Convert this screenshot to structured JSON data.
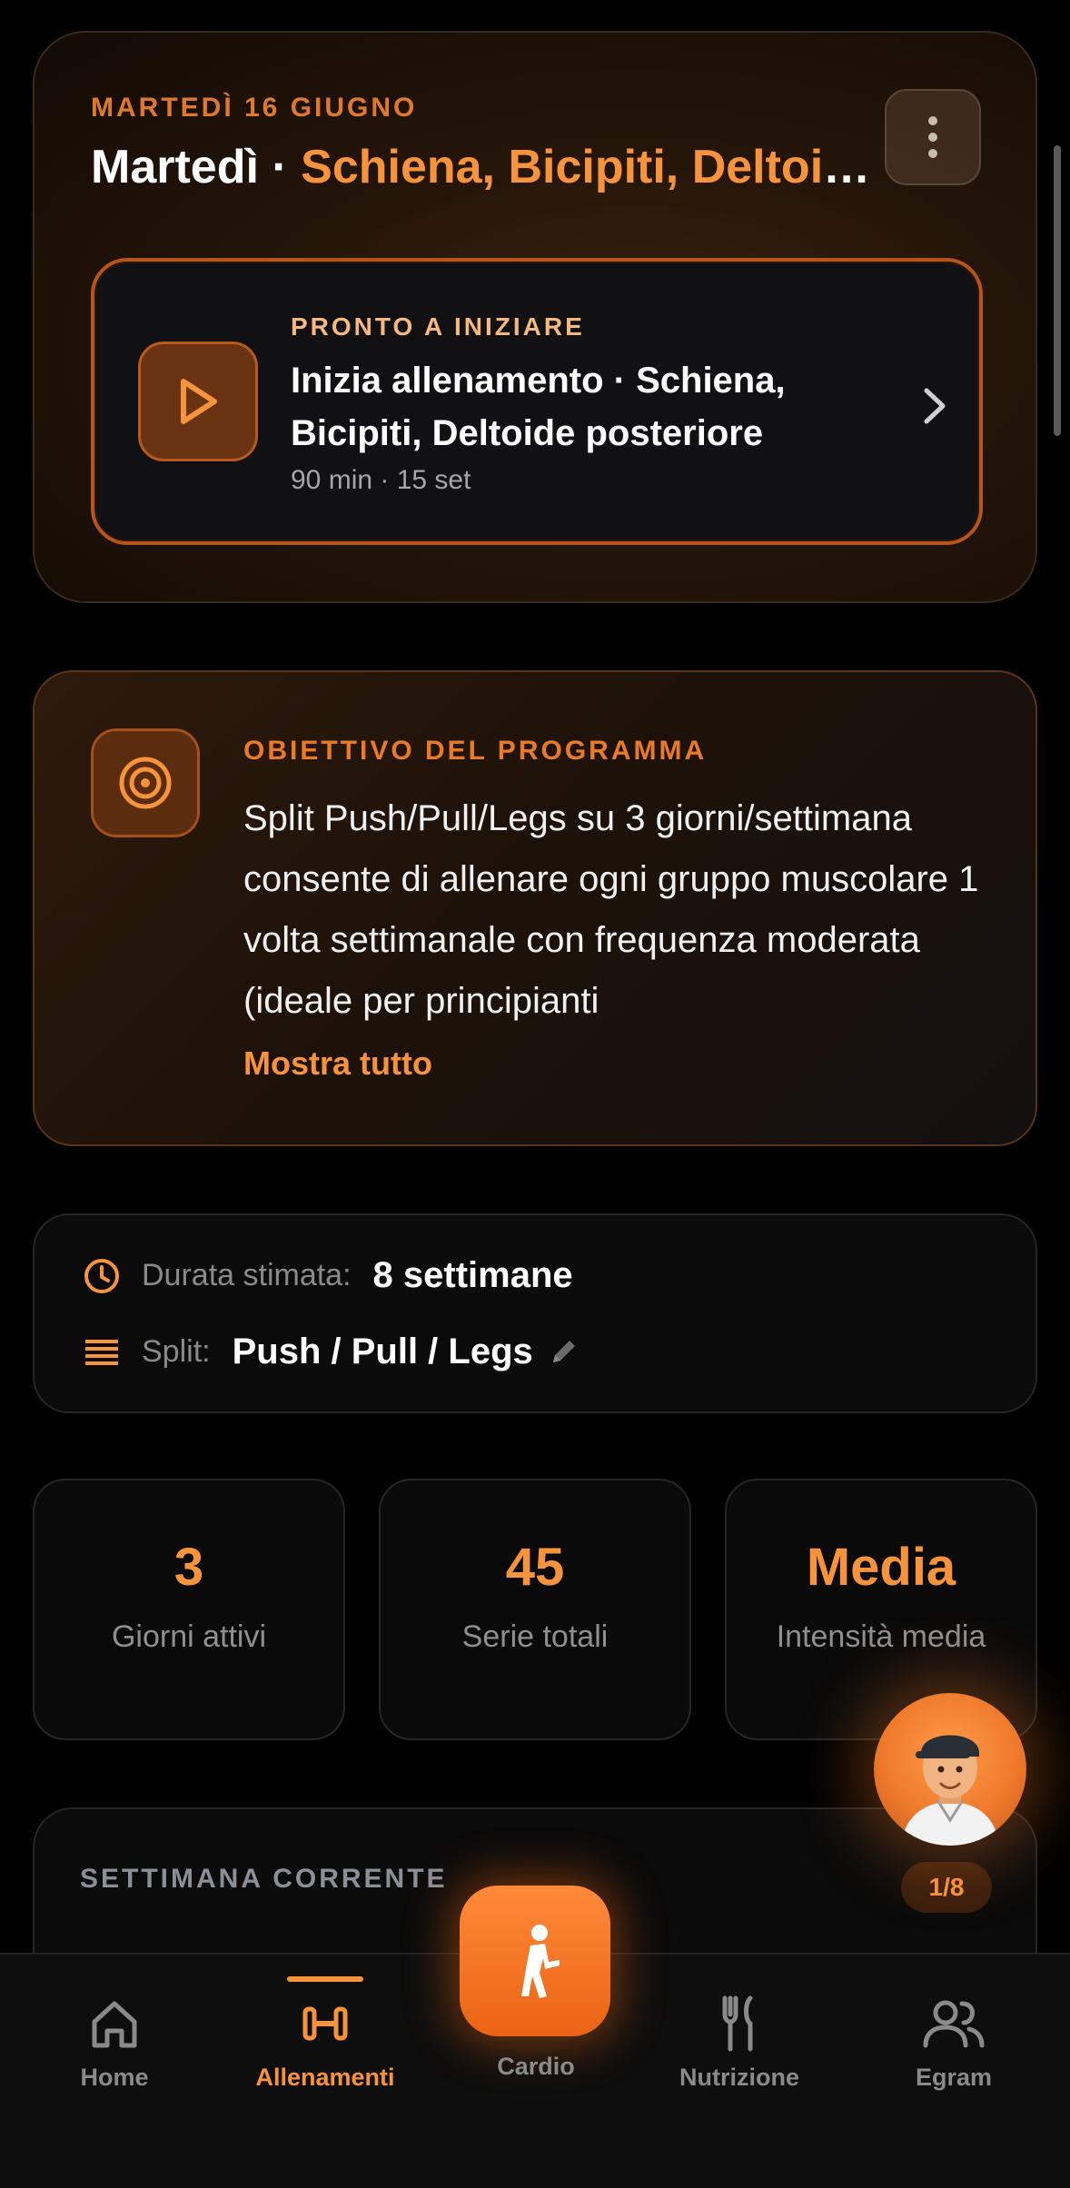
{
  "hero": {
    "date": "MARTEDÌ 16 GIUGNO",
    "title_day": "Martedì · ",
    "title_muscles": "Schiena, Bicipiti, Deltoide posteriore",
    "menu_icon": "more-vertical-icon"
  },
  "start_card": {
    "label": "PRONTO A INIZIARE",
    "title": "Inizia allenamento · Schiena, Bicipiti, Deltoide posteriore",
    "meta": "90 min · 15 set",
    "icon": "play-icon"
  },
  "goal": {
    "label": "OBIETTIVO DEL PROGRAMMA",
    "text": "Split Push/Pull/Legs su 3 giorni/settimana consente di allenare ogni gruppo muscolare 1 volta settimanale con frequenza moderata (ideale per principianti",
    "show_more": "Mostra tutto",
    "icon": "target-icon"
  },
  "info": {
    "duration_label": "Durata stimata:",
    "duration_value": "8 settimane",
    "split_label": "Split:",
    "split_value": "Push / Pull / Legs"
  },
  "stats": [
    {
      "value": "3",
      "caption": "Giorni attivi"
    },
    {
      "value": "45",
      "caption": "Serie totali"
    },
    {
      "value": "Media",
      "caption": "Intensità media"
    }
  ],
  "week": {
    "label": "SETTIMANA CORRENTE",
    "badge": "1/8"
  },
  "nav": {
    "items": [
      {
        "label": "Home",
        "icon": "home-icon"
      },
      {
        "label": "Allenamenti",
        "icon": "dumbbell-icon"
      },
      {
        "label": "Cardio",
        "icon": "running-icon"
      },
      {
        "label": "Nutrizione",
        "icon": "fork-knife-icon"
      },
      {
        "label": "Egram",
        "icon": "users-icon"
      }
    ],
    "active_index": 1
  },
  "colors": {
    "accent": "#f7943b",
    "accent_dark": "#ea6414",
    "background": "#000000"
  }
}
